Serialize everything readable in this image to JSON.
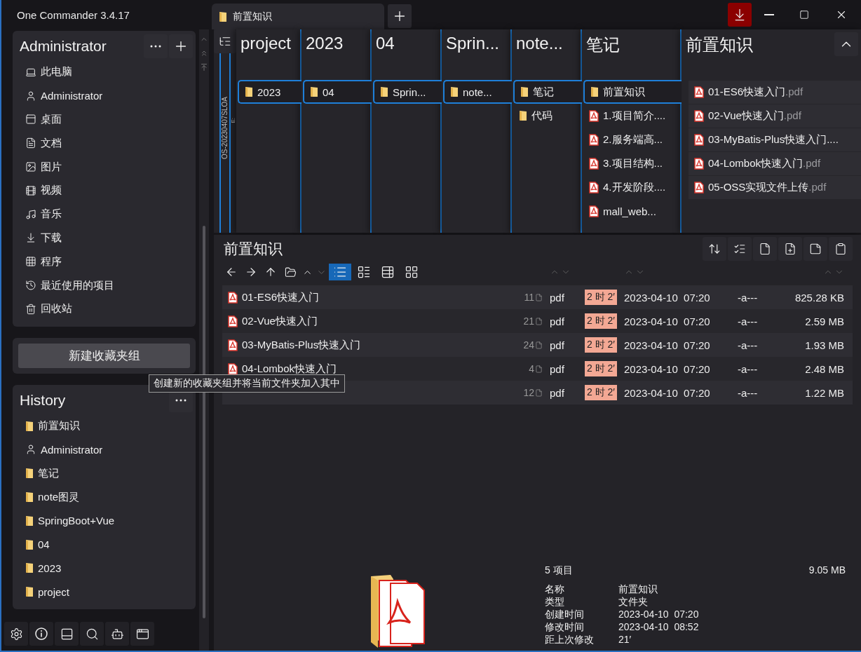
{
  "window": {
    "title": "One Commander 3.4.17"
  },
  "tabs": [
    {
      "label": "前置知识",
      "selected": true
    }
  ],
  "favorites": {
    "title": "Administrator",
    "items": [
      "此电脑",
      "Administrator",
      "桌面",
      "文档",
      "图片",
      "视频",
      "音乐",
      "下载",
      "程序",
      "最近使用的项目",
      "回收站"
    ]
  },
  "new_group_button": "新建收藏夹组",
  "history": {
    "title": "History",
    "items": [
      {
        "label": "前置知识",
        "kind": "folder"
      },
      {
        "label": "Administrator",
        "kind": "user"
      },
      {
        "label": "笔记",
        "kind": "folder"
      },
      {
        "label": "note图灵",
        "kind": "folder"
      },
      {
        "label": "SpringBoot+Vue",
        "kind": "folder"
      },
      {
        "label": "04",
        "kind": "folder"
      },
      {
        "label": "2023",
        "kind": "folder"
      },
      {
        "label": "project",
        "kind": "folder"
      }
    ]
  },
  "drive": {
    "label": "OS-20230407SLOA",
    "letter": "E:"
  },
  "columns": [
    {
      "title": "project",
      "kind": "path",
      "items": [
        {
          "label": "2023",
          "kind": "folder",
          "selected": true
        }
      ]
    },
    {
      "title": "2023",
      "kind": "path",
      "items": [
        {
          "label": "04",
          "kind": "folder",
          "selected": true
        }
      ]
    },
    {
      "title": "04",
      "kind": "path",
      "items": [
        {
          "label": "Sprin...",
          "kind": "folder",
          "selected": true
        }
      ]
    },
    {
      "title": "Sprin...",
      "kind": "path",
      "items": [
        {
          "label": "note...",
          "kind": "folder",
          "selected": true
        }
      ]
    },
    {
      "title": "note...",
      "kind": "path",
      "items": [
        {
          "label": "笔记",
          "kind": "folder",
          "selected": true
        },
        {
          "label": "代码",
          "kind": "folder",
          "selected": false
        }
      ]
    },
    {
      "title": "笔记",
      "kind": "path",
      "items": [
        {
          "label": "前置知识",
          "kind": "folder",
          "selected": true
        },
        {
          "label": "1.项目简介....",
          "kind": "pdf",
          "selected": false
        },
        {
          "label": "2.服务端高...",
          "kind": "pdf",
          "selected": false
        },
        {
          "label": "3.项目结构...",
          "kind": "pdf",
          "selected": false
        },
        {
          "label": "4.开发阶段....",
          "kind": "pdf",
          "selected": false
        },
        {
          "label": "mall_web...",
          "kind": "pdf",
          "selected": false
        }
      ]
    },
    {
      "title": "前置知识",
      "kind": "current",
      "items": [
        {
          "label": "01-ES6快速入门",
          "ext": ".pdf",
          "kind": "pdf",
          "selected": false
        },
        {
          "label": "02-Vue快速入门",
          "ext": ".pdf",
          "kind": "pdf",
          "selected": false
        },
        {
          "label": "03-MyBatis-Plus快速入门....",
          "kind": "pdf",
          "selected": false
        },
        {
          "label": "04-Lombok快速入门",
          "ext": ".pdf",
          "kind": "pdf",
          "selected": false
        },
        {
          "label": "05-OSS实现文件上传",
          "ext": ".pdf",
          "kind": "pdf",
          "selected": false
        }
      ]
    }
  ],
  "panel": {
    "title": "前置知识",
    "view_modes": [
      {
        "selected": true
      },
      {
        "selected": false
      },
      {
        "selected": false
      },
      {
        "selected": false
      }
    ],
    "rows": [
      {
        "name": "01-ES6快速入门",
        "pages": "11",
        "type": "pdf",
        "age": "2 时 2′",
        "date": "2023-04-10  07:20",
        "attributes": "-a---",
        "size": "825.28 KB"
      },
      {
        "name": "02-Vue快速入门",
        "pages": "21",
        "type": "pdf",
        "age": "2 时 2′",
        "date": "2023-04-10  07:20",
        "attributes": "-a---",
        "size": "2.59 MB"
      },
      {
        "name": "03-MyBatis-Plus快速入门",
        "pages": "24",
        "type": "pdf",
        "age": "2 时 2′",
        "date": "2023-04-10  07:20",
        "attributes": "-a---",
        "size": "1.93 MB"
      },
      {
        "name": "04-Lombok快速入门",
        "pages": "4",
        "type": "pdf",
        "age": "2 时 2′",
        "date": "2023-04-10  07:20",
        "attributes": "-a---",
        "size": "2.48 MB"
      },
      {
        "pages": "12",
        "type": "pdf",
        "age": "2 时 2′",
        "date": "2023-04-10  07:20",
        "attributes": "-a---",
        "size": "1.22 MB"
      }
    ]
  },
  "tooltip": "创建新的收藏夹组并将当前文件夹加入其中",
  "details": {
    "count": "5 项目",
    "total_size": "9.05 MB",
    "properties": [
      {
        "label": "名称",
        "value": "前置知识"
      },
      {
        "label": "类型",
        "value": "文件夹"
      },
      {
        "label": "创建时间",
        "value": "2023-04-10  07:20"
      },
      {
        "label": "修改时间",
        "value": "2023-04-10  08:52"
      },
      {
        "label": "距上次修改",
        "value": "21′"
      }
    ]
  }
}
